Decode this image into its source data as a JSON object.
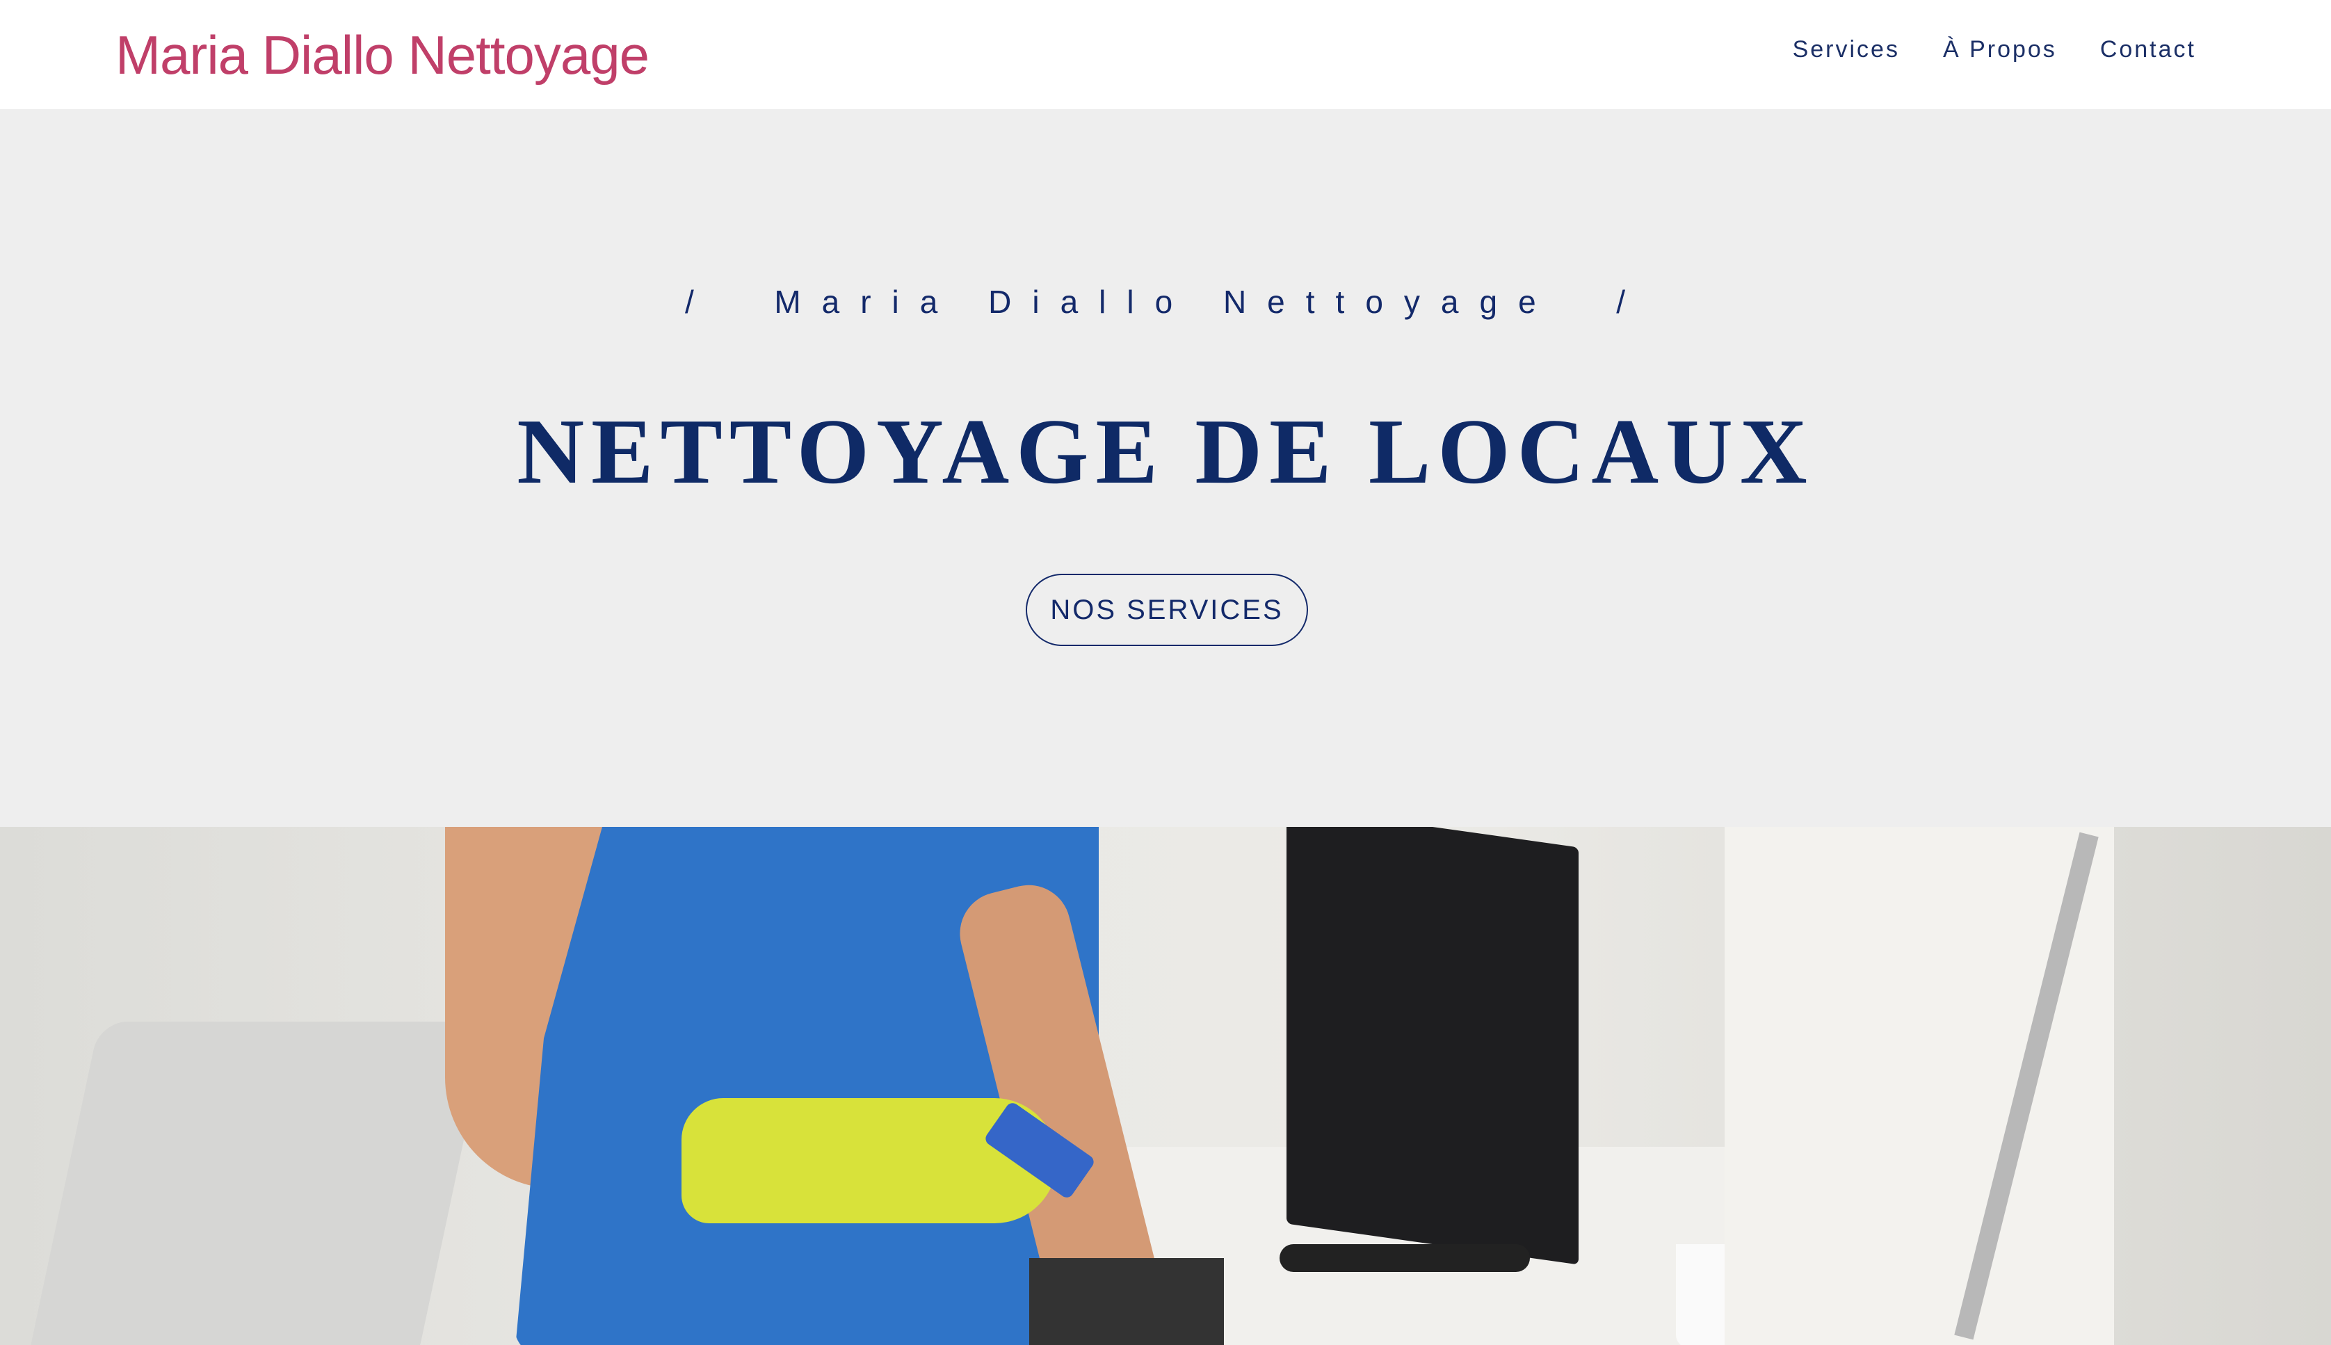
{
  "header": {
    "logo": "Maria Diallo Nettoyage",
    "nav": [
      {
        "label": "Services"
      },
      {
        "label": "À Propos"
      },
      {
        "label": "Contact"
      }
    ]
  },
  "hero": {
    "kicker": "/  Maria Diallo Nettoyage  /",
    "title": "NETTOYAGE DE LOCAUX",
    "button": "NOS SERVICES"
  },
  "colors": {
    "brand": "#c03f69",
    "navy": "#13296a",
    "hero_bg": "#eeeeee"
  }
}
